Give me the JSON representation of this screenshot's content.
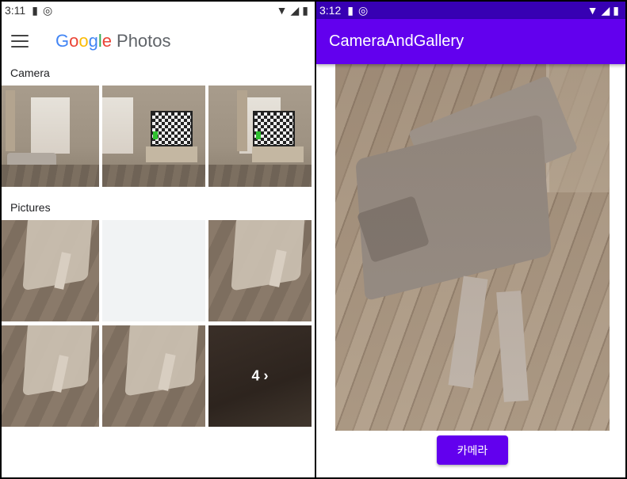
{
  "left_phone": {
    "status": {
      "time": "3:11"
    },
    "header": {
      "logo_google": [
        "G",
        "o",
        "o",
        "g",
        "l",
        "e"
      ],
      "logo_photos": "Photos"
    },
    "sections": [
      {
        "title": "Camera"
      },
      {
        "title": "Pictures"
      }
    ],
    "more_tile": {
      "label": "4 ›"
    }
  },
  "right_phone": {
    "status": {
      "time": "3:12"
    },
    "appbar": {
      "title": "CameraAndGallery"
    },
    "button": {
      "label": "카메라"
    }
  },
  "colors": {
    "primary": "#6200ee",
    "status_dark": "#3700b3"
  },
  "icons": [
    "menu-icon",
    "sd-card-icon",
    "sync-icon",
    "wifi-icon",
    "signal-icon",
    "battery-icon",
    "chevron-right-icon"
  ]
}
